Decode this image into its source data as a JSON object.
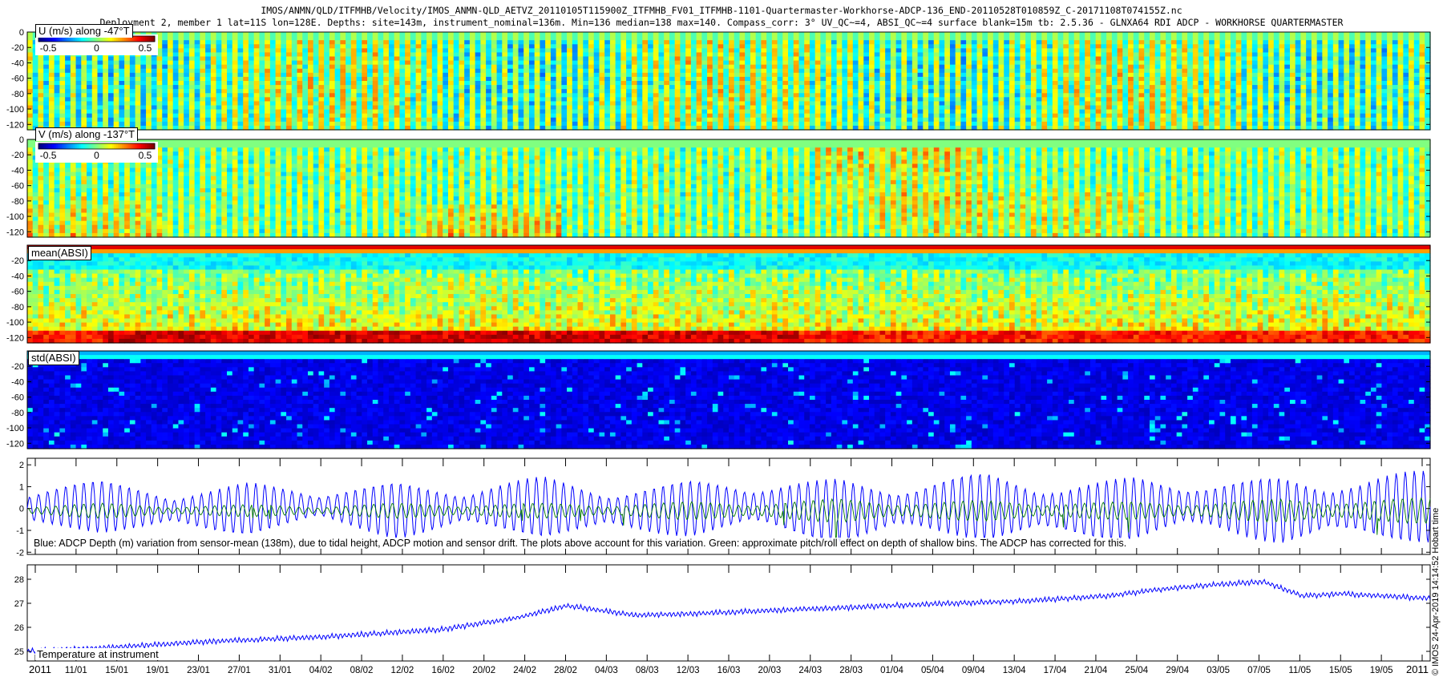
{
  "header": {
    "title_line1": "IMOS/ANMN/QLD/ITFMHB/Velocity/IMOS_ANMN-QLD_AETVZ_20110105T115900Z_ITFMHB_FV01_ITFMHB-1101-Quartermaster-Workhorse-ADCP-136_END-20110528T010859Z_C-20171108T074155Z.nc",
    "title_line2": "Deployment 2, member 1 lat=11S lon=128E. Depths: site=143m, instrument_nominal=136m. Min=136 median=138 max=140. Compass_corr: 3° UV_QC~=4, ABSI_QC~=4 surface blank=15m tb: 2.5.36 - GLNXA64 RDI ADCP - WORKHORSE QUARTERMASTER"
  },
  "stamp": "© IMOS 24-Apr-2019 14:14:52 Hobart time",
  "colors": {
    "blue_series": "#0000ff",
    "green_series": "#007700"
  },
  "chart_data": [
    {
      "type": "heatmap",
      "label": "U (m/s) along -47°T",
      "colorbar_ticks": [
        "-0.5",
        "0",
        "0.5"
      ],
      "clim": [
        -0.6,
        0.6
      ],
      "y_ticks": [
        "0",
        "-20",
        "-40",
        "-60",
        "-80",
        "-100",
        "-120"
      ],
      "ylim": [
        -127,
        0
      ]
    },
    {
      "type": "heatmap",
      "label": "V (m/s) along -137°T",
      "colorbar_ticks": [
        "-0.5",
        "0",
        "0.5"
      ],
      "clim": [
        -0.6,
        0.6
      ],
      "y_ticks": [
        "0",
        "-20",
        "-40",
        "-60",
        "-80",
        "-100",
        "-120"
      ],
      "ylim": [
        -127,
        0
      ]
    },
    {
      "type": "heatmap",
      "label": "mean(ABSI)",
      "y_ticks": [
        "-20",
        "-40",
        "-60",
        "-80",
        "-100",
        "-120"
      ],
      "ylim": [
        -127,
        0
      ]
    },
    {
      "type": "heatmap",
      "label": "std(ABSI)",
      "y_ticks": [
        "-20",
        "-40",
        "-60",
        "-80",
        "-100",
        "-120"
      ],
      "ylim": [
        -127,
        0
      ]
    },
    {
      "type": "line",
      "caption": "Blue: ADCP Depth (m) variation from sensor-mean (138m), due to tidal height, ADCP motion and sensor drift. The plots above account for this variation. Green: approximate pitch/roll effect on depth of shallow bins. The ADCP has corrected for this.",
      "ylim": [
        -2.1,
        2.3
      ],
      "y_ticks": [
        "2",
        "1",
        "0",
        "-1",
        "-2"
      ],
      "series": [
        {
          "color": "#0000ff",
          "amplitude_envelope": [
            0.9,
            1.2,
            0.8,
            1.2,
            0.7,
            1.3,
            0.9,
            1.4,
            0.9,
            1.3,
            1.0,
            1.5,
            1.0,
            1.6,
            1.1,
            1.5,
            1.0,
            1.6,
            1.2,
            1.8
          ]
        },
        {
          "color": "#007700",
          "amplitude_envelope": [
            0.3,
            0.5,
            0.3,
            0.4,
            0.3,
            0.5,
            0.4,
            0.5,
            0.4,
            0.6,
            0.5,
            0.8,
            0.5,
            0.7,
            0.5,
            0.6,
            0.5,
            0.8,
            0.6,
            0.9
          ]
        }
      ]
    },
    {
      "type": "line",
      "label": "Temperature at instrument",
      "ylim": [
        24.6,
        28.6
      ],
      "y_ticks": [
        "28",
        "27",
        "26",
        "25"
      ],
      "series": [
        {
          "color": "#0000ff",
          "x": [
            "2011-01-05",
            "2011-01-15",
            "2011-01-23",
            "2011-02-04",
            "2011-02-16",
            "2011-02-24",
            "2011-03-01",
            "2011-03-08",
            "2011-03-16",
            "2011-03-28",
            "2011-04-09",
            "2011-04-17",
            "2011-04-25",
            "2011-05-01",
            "2011-05-07",
            "2011-05-11",
            "2011-05-15",
            "2011-05-19",
            "2011-05-28"
          ],
          "y": [
            25.0,
            25.2,
            25.4,
            25.6,
            25.9,
            26.4,
            26.9,
            26.5,
            26.6,
            26.8,
            27.0,
            27.1,
            27.3,
            27.6,
            27.8,
            27.9,
            27.3,
            27.4,
            27.2
          ]
        }
      ]
    }
  ],
  "x_axis": {
    "tick_labels": [
      "2011",
      "11/01",
      "15/01",
      "19/01",
      "23/01",
      "27/01",
      "31/01",
      "04/02",
      "08/02",
      "12/02",
      "16/02",
      "20/02",
      "24/02",
      "28/02",
      "04/03",
      "08/03",
      "12/03",
      "16/03",
      "20/03",
      "24/03",
      "28/03",
      "01/04",
      "05/04",
      "09/04",
      "13/04",
      "17/04",
      "21/04",
      "25/04",
      "29/04",
      "03/05",
      "07/05",
      "11/05",
      "15/05",
      "19/05",
      "2011"
    ]
  }
}
